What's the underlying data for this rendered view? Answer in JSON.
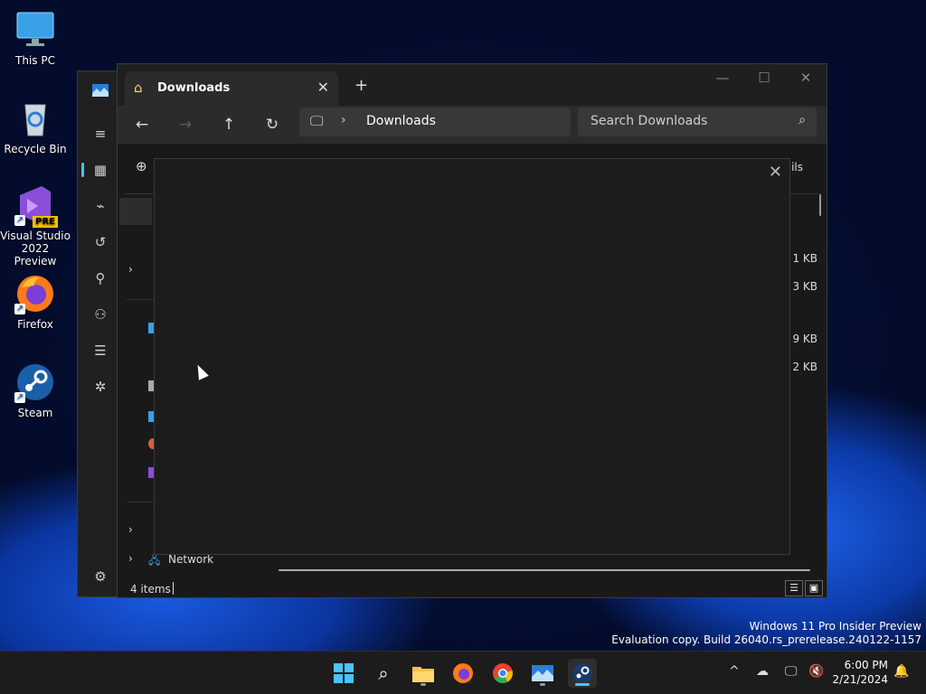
{
  "desktop": {
    "icons": [
      {
        "label": "This PC"
      },
      {
        "label": "Recycle Bin"
      },
      {
        "label": "Visual Studio 2022 Preview",
        "badge": "PRE"
      },
      {
        "label": "Firefox"
      },
      {
        "label": "Steam"
      }
    ]
  },
  "explorer": {
    "tab_title": "Downloads",
    "breadcrumb": "Downloads",
    "search_placeholder": "Search Downloads",
    "cmdbar_details_fragment": "ails",
    "sidebar_network_label": "Network",
    "size_fragments": [
      "1 KB",
      "3 KB",
      "9 KB",
      "2 KB"
    ],
    "status_count": "4 items"
  },
  "watermark": {
    "line1": "Windows 11 Pro Insider Preview",
    "line2": "Evaluation copy. Build 26040.rs_prerelease.240122-1157"
  },
  "taskbar": {
    "time": "6:00 PM",
    "date": "2/21/2024"
  },
  "colors": {
    "accent": "#4cc2ff",
    "window_bg": "#191919",
    "toolbar_bg": "#2b2b2b"
  }
}
